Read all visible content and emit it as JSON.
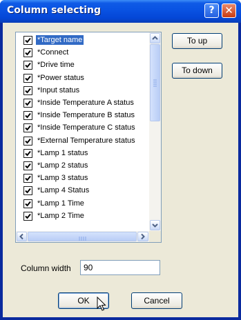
{
  "window": {
    "title": "Column selecting",
    "help_glyph": "?",
    "close_glyph": "✕"
  },
  "columns": [
    {
      "label": "*Target name",
      "checked": true,
      "selected": true
    },
    {
      "label": "*Connect",
      "checked": true
    },
    {
      "label": "*Drive time",
      "checked": true
    },
    {
      "label": "*Power status",
      "checked": true
    },
    {
      "label": "*Input status",
      "checked": true
    },
    {
      "label": "*Inside Temperature A status",
      "checked": true
    },
    {
      "label": "*Inside Temperature B status",
      "checked": true
    },
    {
      "label": "*Inside Temperature C status",
      "checked": true
    },
    {
      "label": "*External Temperature status",
      "checked": true
    },
    {
      "label": "*Lamp 1 status",
      "checked": true
    },
    {
      "label": "*Lamp 2 status",
      "checked": true
    },
    {
      "label": "*Lamp 3 status",
      "checked": true
    },
    {
      "label": "*Lamp 4 Status",
      "checked": true
    },
    {
      "label": "*Lamp 1 Time",
      "checked": true
    },
    {
      "label": "*Lamp 2 Time",
      "checked": true
    }
  ],
  "buttons": {
    "to_up": "To up",
    "to_down": "To down",
    "ok": "OK",
    "cancel": "Cancel"
  },
  "column_width": {
    "label": "Column width",
    "value": "90"
  },
  "colors": {
    "title_bar": "#0a54e3",
    "dialog_face": "#ece9d8",
    "selection": "#316ac5"
  }
}
